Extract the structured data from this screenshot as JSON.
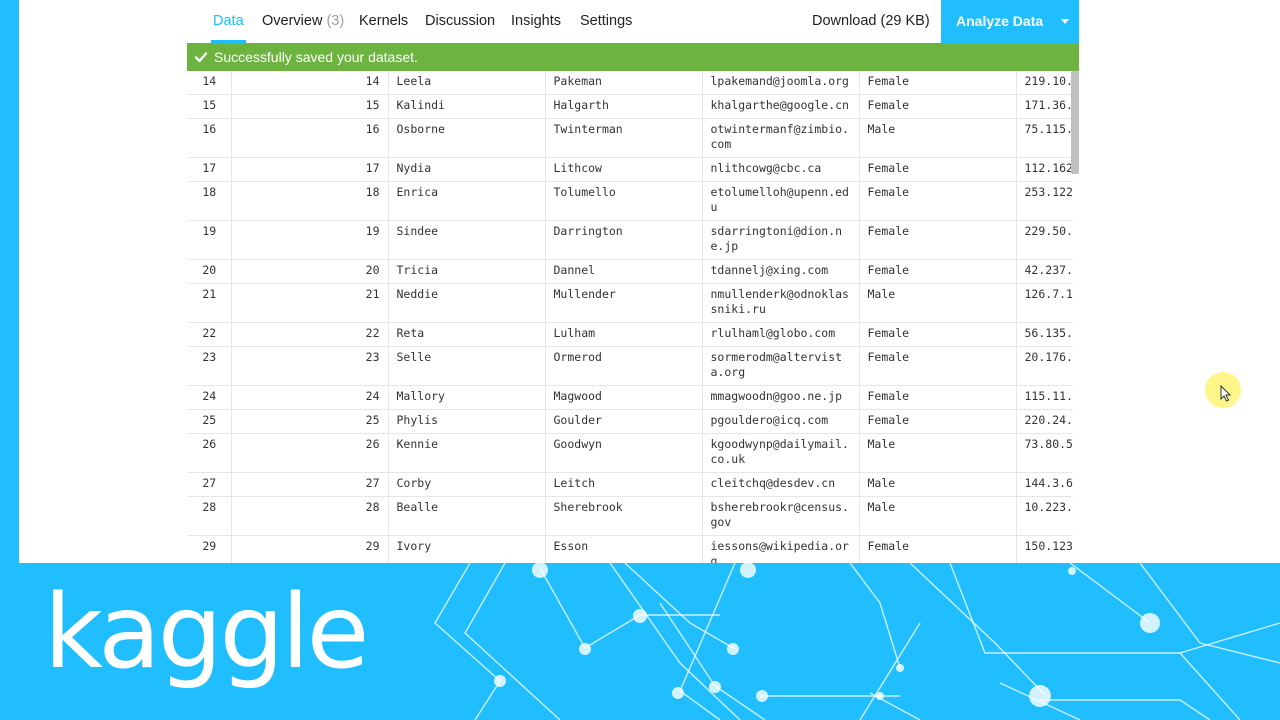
{
  "tabs": [
    {
      "label": "Data",
      "active": true
    },
    {
      "label": "Overview",
      "count": "(3)"
    },
    {
      "label": "Kernels"
    },
    {
      "label": "Discussion"
    },
    {
      "label": "Insights"
    },
    {
      "label": "Settings"
    }
  ],
  "download_label": "Download (29 KB)",
  "analyze_label": "Analyze Data",
  "alert_message": "Successfully saved your dataset.",
  "colors": {
    "accent": "#20BEFF",
    "success": "#6CB43F"
  },
  "rows": [
    {
      "index": "14",
      "id": "14",
      "first_name": "Leela",
      "last_name": "Pakeman",
      "email": "lpakemand@joomla.org",
      "gender": "Female",
      "ip": "219.10."
    },
    {
      "index": "15",
      "id": "15",
      "first_name": "Kalindi",
      "last_name": "Halgarth",
      "email": "khalgarthe@google.cn",
      "gender": "Female",
      "ip": "171.36."
    },
    {
      "index": "16",
      "id": "16",
      "first_name": "Osborne",
      "last_name": "Twinterman",
      "email": "otwintermanf@zimbio.com",
      "gender": "Male",
      "ip": "75.115."
    },
    {
      "index": "17",
      "id": "17",
      "first_name": "Nydia",
      "last_name": "Lithcow",
      "email": "nlithcowg@cbc.ca",
      "gender": "Female",
      "ip": "112.162"
    },
    {
      "index": "18",
      "id": "18",
      "first_name": "Enrica",
      "last_name": "Tolumello",
      "email": "etolumelloh@upenn.edu",
      "gender": "Female",
      "ip": "253.122"
    },
    {
      "index": "19",
      "id": "19",
      "first_name": "Sindee",
      "last_name": "Darrington",
      "email": "sdarringtoni@dion.ne.jp",
      "gender": "Female",
      "ip": "229.50."
    },
    {
      "index": "20",
      "id": "20",
      "first_name": "Tricia",
      "last_name": "Dannel",
      "email": "tdannelj@xing.com",
      "gender": "Female",
      "ip": "42.237."
    },
    {
      "index": "21",
      "id": "21",
      "first_name": "Neddie",
      "last_name": "Mullender",
      "email": "nmullenderk@odnoklassniki.ru",
      "gender": "Male",
      "ip": "126.7.1"
    },
    {
      "index": "22",
      "id": "22",
      "first_name": "Reta",
      "last_name": "Lulham",
      "email": "rlulhaml@globo.com",
      "gender": "Female",
      "ip": "56.135."
    },
    {
      "index": "23",
      "id": "23",
      "first_name": "Selle",
      "last_name": "Ormerod",
      "email": "sormerodm@altervista.org",
      "gender": "Female",
      "ip": "20.176."
    },
    {
      "index": "24",
      "id": "24",
      "first_name": "Mallory",
      "last_name": "Magwood",
      "email": "mmagwoodn@goo.ne.jp",
      "gender": "Female",
      "ip": "115.11."
    },
    {
      "index": "25",
      "id": "25",
      "first_name": "Phylis",
      "last_name": "Goulder",
      "email": "pgouldero@icq.com",
      "gender": "Female",
      "ip": "220.24."
    },
    {
      "index": "26",
      "id": "26",
      "first_name": "Kennie",
      "last_name": "Goodwyn",
      "email": "kgoodwynp@dailymail.co.uk",
      "gender": "Male",
      "ip": "73.80.5"
    },
    {
      "index": "27",
      "id": "27",
      "first_name": "Corby",
      "last_name": "Leitch",
      "email": "cleitchq@desdev.cn",
      "gender": "Male",
      "ip": "144.3.6"
    },
    {
      "index": "28",
      "id": "28",
      "first_name": "Bealle",
      "last_name": "Sherebrook",
      "email": "bsherebrookr@census.gov",
      "gender": "Male",
      "ip": "10.223."
    },
    {
      "index": "29",
      "id": "29",
      "first_name": "Ivory",
      "last_name": "Esson",
      "email": "iessons@wikipedia.org",
      "gender": "Female",
      "ip": "150.123"
    },
    {
      "index": "",
      "id": "",
      "first_name": "",
      "last_name": "",
      "email": "",
      "gender": "",
      "ip": ""
    }
  ],
  "footer": {
    "logo_text": "kaggle"
  }
}
